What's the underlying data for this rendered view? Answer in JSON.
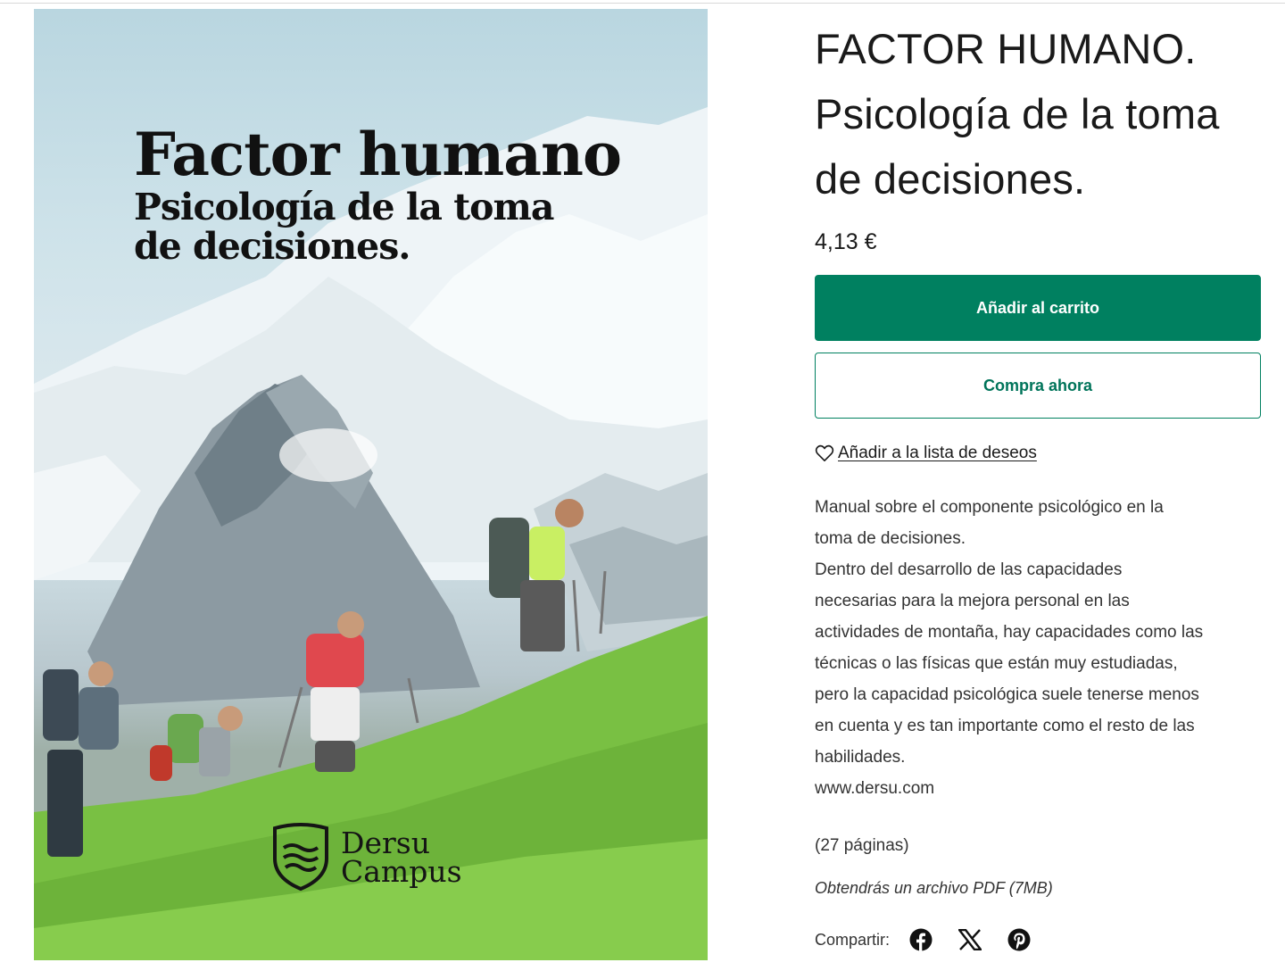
{
  "cover": {
    "title_line1": "Factor humano",
    "title_line2": "Psicología de la toma",
    "title_line3": "de decisiones.",
    "logo_line1": "Dersu",
    "logo_line2": "Campus"
  },
  "product": {
    "title_line1": "FACTOR HUMANO.",
    "title_line2": "Psicología de la toma",
    "title_line3": "de decisiones.",
    "price": "4,13 €"
  },
  "actions": {
    "add_to_cart": "Añadir al carrito",
    "buy_now": "Compra ahora",
    "wishlist": "Añadir a la lista de deseos"
  },
  "description": {
    "lines": [
      "Manual sobre el componente psicológico en la",
      "toma de decisiones.",
      "Dentro del desarrollo de las capacidades",
      "necesarias para la mejora personal en las",
      "actividades de montaña, hay capacidades como las",
      "técnicas o las físicas que están muy estudiadas,",
      "pero la capacidad psicológica suele tenerse menos",
      "en cuenta y es tan importante como el resto de las",
      "habilidades.",
      "www.dersu.com"
    ],
    "pages": "(27 páginas)",
    "file_note": "Obtendrás un archivo PDF (7MB)"
  },
  "share": {
    "label": "Compartir:",
    "icons": [
      "facebook-icon",
      "x-icon",
      "pinterest-icon"
    ]
  },
  "colors": {
    "primary": "#008060",
    "text": "#1a1a1a"
  }
}
